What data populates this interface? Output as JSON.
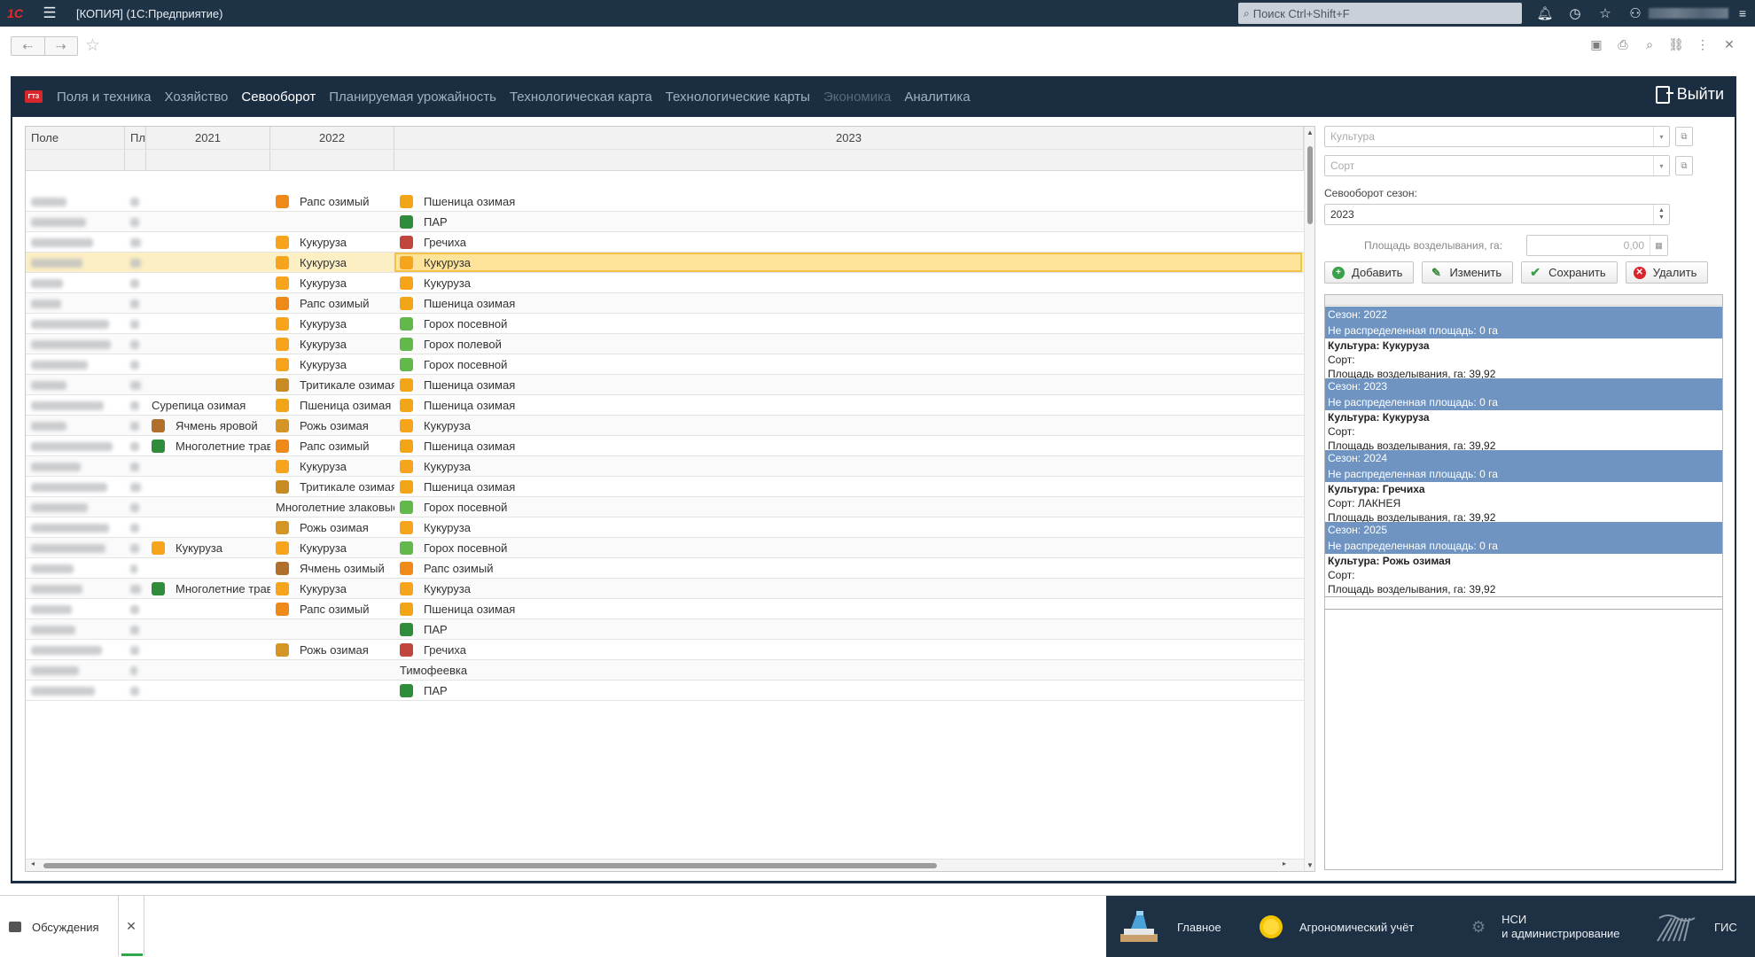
{
  "titlebar": {
    "app_title": "[КОПИЯ]  (1С:Предприятие)",
    "search_placeholder": "Поиск Ctrl+Shift+F"
  },
  "topnav": {
    "tabs": [
      {
        "label": "Поля и техника",
        "state": "normal"
      },
      {
        "label": "Хозяйство",
        "state": "normal"
      },
      {
        "label": "Севооборот",
        "state": "active"
      },
      {
        "label": "Планируемая урожайность",
        "state": "normal"
      },
      {
        "label": "Технологическая карта",
        "state": "normal"
      },
      {
        "label": "Технологические карты",
        "state": "normal"
      },
      {
        "label": "Экономика",
        "state": "disabled"
      },
      {
        "label": "Аналитика",
        "state": "normal"
      }
    ],
    "exit_label": "Выйти"
  },
  "grid": {
    "columns": {
      "field": "Поле",
      "area": "Пл",
      "y2021": "2021",
      "y2022": "2022",
      "y2023": "2023"
    },
    "rows": [
      {
        "c2021": "",
        "i2021": "",
        "c2022": "Рапс озимый",
        "i2022": "rape",
        "c2023": "Пшеница озимая",
        "i2023": "wheat"
      },
      {
        "c2021": "",
        "i2021": "",
        "c2022": "",
        "i2022": "",
        "c2023": "ПАР",
        "i2023": "grass"
      },
      {
        "c2021": "",
        "i2021": "",
        "c2022": "Кукуруза",
        "i2022": "corn",
        "c2023": "Гречиха",
        "i2023": "buck"
      },
      {
        "c2021": "",
        "i2021": "",
        "c2022": "Кукуруза",
        "i2022": "corn",
        "c2023": "Кукуруза",
        "i2023": "corn"
      },
      {
        "c2021": "",
        "i2021": "",
        "c2022": "Кукуруза",
        "i2022": "corn",
        "c2023": "Кукуруза",
        "i2023": "corn"
      },
      {
        "c2021": "",
        "i2021": "",
        "c2022": "Рапс озимый",
        "i2022": "rape",
        "c2023": "Пшеница озимая",
        "i2023": "wheat"
      },
      {
        "c2021": "",
        "i2021": "",
        "c2022": "Кукуруза",
        "i2022": "corn",
        "c2023": "Горох посевной",
        "i2023": "pea"
      },
      {
        "c2021": "",
        "i2021": "",
        "c2022": "Кукуруза",
        "i2022": "corn",
        "c2023": "Горох полевой",
        "i2023": "pea"
      },
      {
        "c2021": "",
        "i2021": "",
        "c2022": "Кукуруза",
        "i2022": "corn",
        "c2023": "Горох посевной",
        "i2023": "pea"
      },
      {
        "c2021": "",
        "i2021": "",
        "c2022": "Тритикале озимая",
        "i2022": "trit",
        "c2023": "Пшеница озимая",
        "i2023": "wheat"
      },
      {
        "c2021": "Сурепица озимая",
        "i2021": "",
        "c2022": "Пшеница озимая",
        "i2022": "wheat",
        "c2023": "Пшеница озимая",
        "i2023": "wheat"
      },
      {
        "c2021": "Ячмень яровой",
        "i2021": "barley",
        "c2022": "Рожь озимая",
        "i2022": "rye",
        "c2023": "Кукуруза",
        "i2023": "corn"
      },
      {
        "c2021": "Многолетние травы...",
        "i2021": "grass",
        "c2022": "Рапс озимый",
        "i2022": "rape",
        "c2023": "Пшеница озимая",
        "i2023": "wheat"
      },
      {
        "c2021": "",
        "i2021": "",
        "c2022": "Кукуруза",
        "i2022": "corn",
        "c2023": "Кукуруза",
        "i2023": "corn"
      },
      {
        "c2021": "",
        "i2021": "",
        "c2022": "Тритикале озимая",
        "i2022": "trit",
        "c2023": "Пшеница озимая",
        "i2023": "wheat"
      },
      {
        "c2021": "",
        "i2021": "",
        "c2022": "Многолетние злаковые...",
        "i2022": "",
        "c2023": "Горох посевной",
        "i2023": "pea"
      },
      {
        "c2021": "",
        "i2021": "",
        "c2022": "Рожь озимая",
        "i2022": "rye",
        "c2023": "Кукуруза",
        "i2023": "corn"
      },
      {
        "c2021": "Кукуруза",
        "i2021": "corn",
        "c2022": "Кукуруза",
        "i2022": "corn",
        "c2023": "Горох посевной",
        "i2023": "pea"
      },
      {
        "c2021": "",
        "i2021": "",
        "c2022": "Ячмень озимый",
        "i2022": "barley",
        "c2023": "Рапс озимый",
        "i2023": "rape"
      },
      {
        "c2021": "Многолетние травы...",
        "i2021": "grass",
        "c2022": "Кукуруза",
        "i2022": "corn",
        "c2023": "Кукуруза",
        "i2023": "corn"
      },
      {
        "c2021": "",
        "i2021": "",
        "c2022": "Рапс озимый",
        "i2022": "rape",
        "c2023": "Пшеница озимая",
        "i2023": "wheat"
      },
      {
        "c2021": "",
        "i2021": "",
        "c2022": "",
        "i2022": "",
        "c2023": "ПАР",
        "i2023": "grass"
      },
      {
        "c2021": "",
        "i2021": "",
        "c2022": "Рожь озимая",
        "i2022": "rye",
        "c2023": "Гречиха",
        "i2023": "buck"
      },
      {
        "c2021": "",
        "i2021": "",
        "c2022": "",
        "i2022": "",
        "c2023": "Тимофеевка",
        "i2023": ""
      },
      {
        "c2021": "",
        "i2021": "",
        "c2022": "",
        "i2022": "",
        "c2023": "ПАР",
        "i2023": "grass"
      }
    ]
  },
  "panel": {
    "culture_placeholder": "Культура",
    "sort_placeholder": "Сорт",
    "season_label": "Севооборот сезон:",
    "season_value": "2023",
    "area_label": "Площадь возделывания, га:",
    "area_value": "0,00",
    "buttons": {
      "add": "Добавить",
      "edit": "Изменить",
      "save": "Сохранить",
      "delete": "Удалить"
    },
    "seasons": [
      {
        "season": "Сезон: 2022",
        "unalloc": "Не распределенная площадь: 0 га",
        "culture": "Культура: Кукуруза",
        "sort": "Сорт:",
        "area": "Площадь возделывания, га: 39,92"
      },
      {
        "season": "Сезон: 2023",
        "unalloc": "Не распределенная площадь: 0 га",
        "culture": "Культура: Кукуруза",
        "sort": "Сорт:",
        "area": "Площадь возделывания, га: 39,92"
      },
      {
        "season": "Сезон: 2024",
        "unalloc": "Не распределенная площадь: 0 га",
        "culture": "Культура: Гречиха",
        "sort": "Сорт: ЛАКНЕЯ",
        "area": "Площадь возделывания, га: 39,92"
      },
      {
        "season": "Сезон: 2025",
        "unalloc": "Не распределенная площадь: 0 га",
        "culture": "Культура: Рожь озимая",
        "sort": "Сорт:",
        "area": "Площадь возделывания, га: 39,92"
      }
    ]
  },
  "bottombar": {
    "discussions": "Обсуждения",
    "sections": [
      {
        "label": "Главное"
      },
      {
        "label": "Агрономический учёт"
      },
      {
        "label": "НСИ\nи администрирование"
      },
      {
        "label": "ГИС"
      }
    ]
  }
}
